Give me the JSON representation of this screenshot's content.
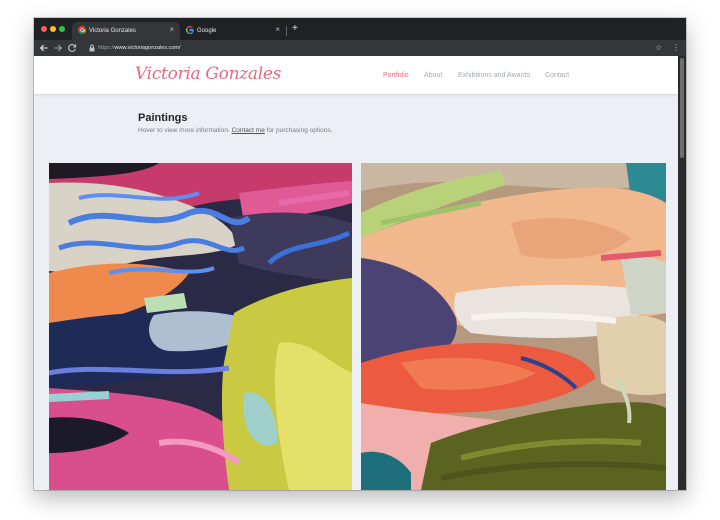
{
  "browser": {
    "tabs": [
      {
        "title": "Victoria Gonzales",
        "active": true,
        "favicon": "chrome-icon"
      },
      {
        "title": "Google",
        "active": false,
        "favicon": "google-g-icon"
      }
    ],
    "new_tab": "+",
    "close_glyph": "×",
    "url_prefix": "https://",
    "url_host": "www.victoriagonzales.com/",
    "icons": [
      "back-arrow-icon",
      "forward-arrow-icon",
      "reload-icon",
      "lock-icon",
      "star-icon",
      "more-vert-icon"
    ]
  },
  "site": {
    "logo": "Victoria Gonzales",
    "nav": [
      {
        "label": "Portfolio",
        "active": true
      },
      {
        "label": "About",
        "active": false
      },
      {
        "label": "Exhibitions and Awards",
        "active": false
      },
      {
        "label": "Contact",
        "active": false
      }
    ],
    "heading": "Paintings",
    "subtitle_before": "Hover to view more information.",
    "subtitle_link": "Contact me",
    "subtitle_after": "for purchasing options."
  },
  "colors": {
    "accent": "#e7687f",
    "page_background": "#ecf0f4",
    "browser_chrome": "#202124"
  }
}
